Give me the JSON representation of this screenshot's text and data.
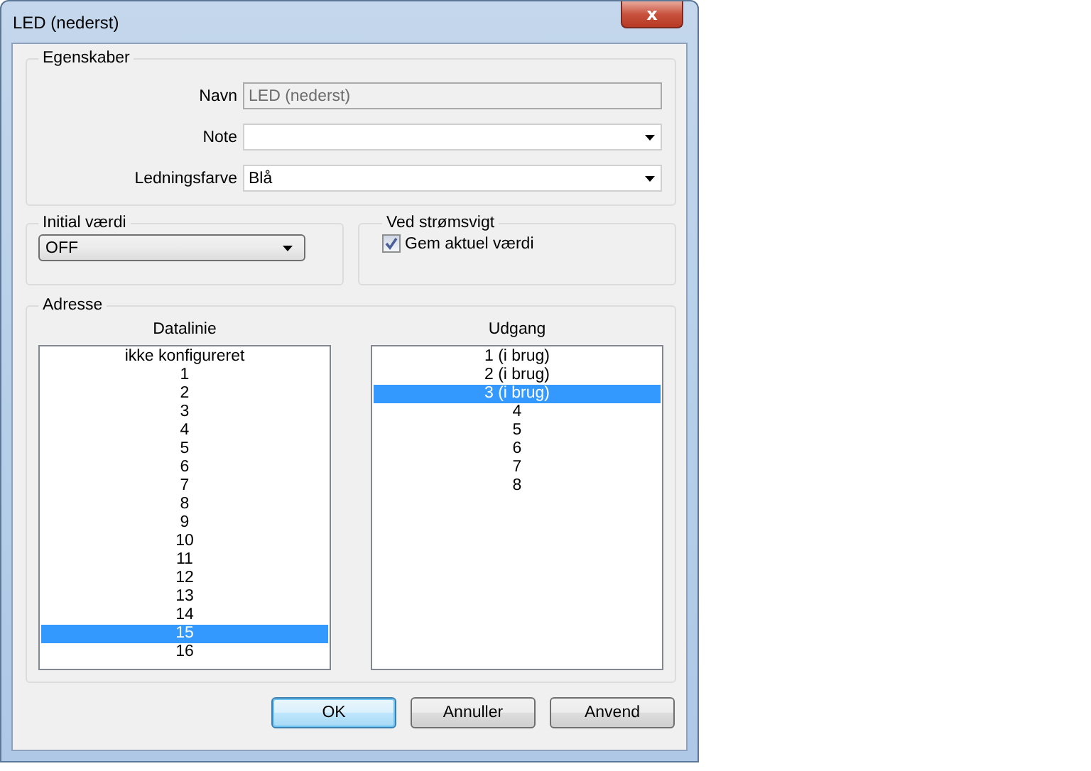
{
  "window": {
    "title": "LED (nederst)",
    "close": "x"
  },
  "egenskaber": {
    "title": "Egenskaber",
    "fields": [
      {
        "label": "Navn",
        "kind": "readonly",
        "value": "LED (nederst)",
        "disabled": true
      },
      {
        "label": "Note",
        "kind": "dropdown"
      },
      {
        "label": "Ledningsfarve",
        "kind": "dropdown",
        "value": "Blå"
      }
    ]
  },
  "initial": {
    "title": "Initial værdi",
    "value": "OFF"
  },
  "power_loss": {
    "title": "Ved strømsvigt",
    "checkbox": {
      "label": "Gem aktuel værdi",
      "checked": true
    }
  },
  "adresse": {
    "title": "Adresse",
    "lists": [
      {
        "title": "Datalinie",
        "items": [
          {
            "label": "ikke konfigureret",
            "selected": false
          },
          {
            "label": "1",
            "selected": false
          },
          {
            "label": "2",
            "selected": false
          },
          {
            "label": "3",
            "selected": false
          },
          {
            "label": "4",
            "selected": false
          },
          {
            "label": "5",
            "selected": false
          },
          {
            "label": "6",
            "selected": false
          },
          {
            "label": "7",
            "selected": false
          },
          {
            "label": "8",
            "selected": false
          },
          {
            "label": "9",
            "selected": false
          },
          {
            "label": "10",
            "selected": false
          },
          {
            "label": "11",
            "selected": false
          },
          {
            "label": "12",
            "selected": false
          },
          {
            "label": "13",
            "selected": false
          },
          {
            "label": "14",
            "selected": false
          },
          {
            "label": "15",
            "selected": true
          },
          {
            "label": "16",
            "selected": false
          }
        ]
      },
      {
        "title": "Udgang",
        "items": [
          {
            "label": "1 (i brug)",
            "selected": false
          },
          {
            "label": "2 (i brug)",
            "selected": false
          },
          {
            "label": "3 (i brug)",
            "selected": true
          },
          {
            "label": "4",
            "selected": false
          },
          {
            "label": "5",
            "selected": false
          },
          {
            "label": "6",
            "selected": false
          },
          {
            "label": "7",
            "selected": false
          },
          {
            "label": "8",
            "selected": false
          }
        ]
      }
    ]
  },
  "buttons": [
    {
      "label": "OK",
      "default": true
    },
    {
      "label": "Annuller",
      "default": false
    },
    {
      "label": "Anvend",
      "default": false
    }
  ]
}
